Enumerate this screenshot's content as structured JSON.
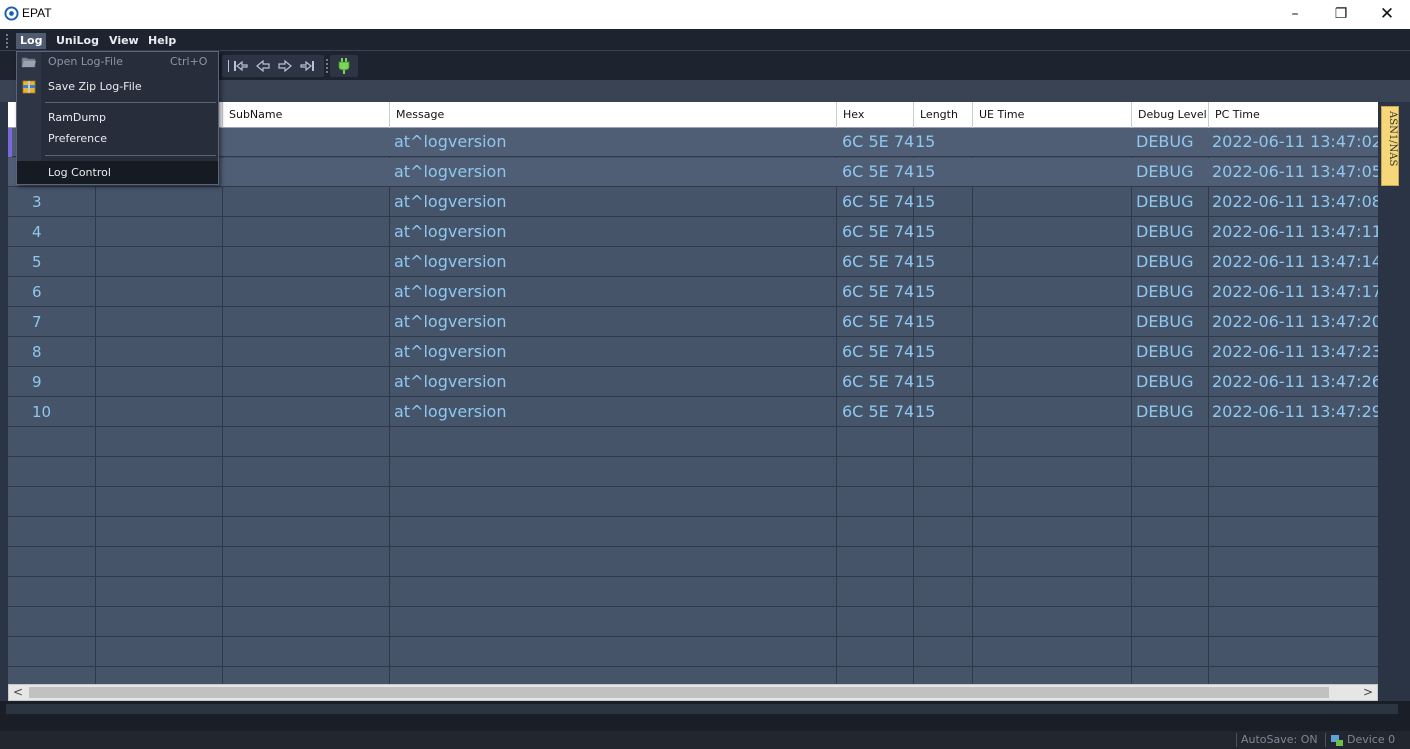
{
  "window": {
    "title": "EPAT",
    "minimize": "–",
    "maximize": "❐",
    "close": "✕"
  },
  "menubar": {
    "items": [
      {
        "label": "Log"
      },
      {
        "label": "UniLog"
      },
      {
        "label": "View"
      },
      {
        "label": "Help"
      }
    ]
  },
  "log_menu": {
    "items": [
      {
        "label": "Open Log-File",
        "shortcut": "Ctrl+O",
        "enabled": false
      },
      {
        "label": "Save Zip Log-File",
        "enabled": true
      },
      {
        "label": "RamDump",
        "enabled": true
      },
      {
        "label": "Preference",
        "enabled": true
      },
      {
        "label": "Log Control",
        "enabled": true,
        "highlighted": true
      }
    ]
  },
  "toolbar": {
    "icons": [
      "first-icon",
      "prev-icon",
      "next-icon",
      "last-icon",
      "plug-icon"
    ]
  },
  "table": {
    "columns": [
      "SubName",
      "Message",
      "Hex",
      "Length",
      "UE Time",
      "Debug Level",
      "PC Time"
    ],
    "rows": [
      {
        "id": "",
        "subname": "",
        "message": "at^logversion",
        "hex": "6C 5E 74",
        "length": "15",
        "ue_time": "",
        "level": "DEBUG",
        "pc_time": "2022-06-11 13:47:02."
      },
      {
        "id": "",
        "subname": "",
        "message": "at^logversion",
        "hex": "6C 5E 74",
        "length": "15",
        "ue_time": "",
        "level": "DEBUG",
        "pc_time": "2022-06-11 13:47:05."
      },
      {
        "id": "3",
        "subname": "",
        "message": "at^logversion",
        "hex": "6C 5E 74",
        "length": "15",
        "ue_time": "",
        "level": "DEBUG",
        "pc_time": "2022-06-11 13:47:08."
      },
      {
        "id": "4",
        "subname": "",
        "message": "at^logversion",
        "hex": "6C 5E 74",
        "length": "15",
        "ue_time": "",
        "level": "DEBUG",
        "pc_time": "2022-06-11 13:47:11."
      },
      {
        "id": "5",
        "subname": "",
        "message": "at^logversion",
        "hex": "6C 5E 74",
        "length": "15",
        "ue_time": "",
        "level": "DEBUG",
        "pc_time": "2022-06-11 13:47:14."
      },
      {
        "id": "6",
        "subname": "",
        "message": "at^logversion",
        "hex": "6C 5E 74",
        "length": "15",
        "ue_time": "",
        "level": "DEBUG",
        "pc_time": "2022-06-11 13:47:17."
      },
      {
        "id": "7",
        "subname": "",
        "message": "at^logversion",
        "hex": "6C 5E 74",
        "length": "15",
        "ue_time": "",
        "level": "DEBUG",
        "pc_time": "2022-06-11 13:47:20."
      },
      {
        "id": "8",
        "subname": "",
        "message": "at^logversion",
        "hex": "6C 5E 74",
        "length": "15",
        "ue_time": "",
        "level": "DEBUG",
        "pc_time": "2022-06-11 13:47:23."
      },
      {
        "id": "9",
        "subname": "",
        "message": "at^logversion",
        "hex": "6C 5E 74",
        "length": "15",
        "ue_time": "",
        "level": "DEBUG",
        "pc_time": "2022-06-11 13:47:26."
      },
      {
        "id": "10",
        "subname": "",
        "message": "at^logversion",
        "hex": "6C 5E 74",
        "length": "15",
        "ue_time": "",
        "level": "DEBUG",
        "pc_time": "2022-06-11 13:47:29."
      }
    ]
  },
  "side_tab": {
    "label": "ASN1/NAS"
  },
  "scrollbar": {
    "left_arrow": "<",
    "right_arrow": ">"
  },
  "status": {
    "autosave": "AutoSave: ON",
    "device": "Device 0"
  },
  "colors": {
    "cell_text": "#8fc7ee",
    "table_bg": "#46546a",
    "menu_bg": "#272d3a",
    "side_tab": "#f6d77a"
  }
}
